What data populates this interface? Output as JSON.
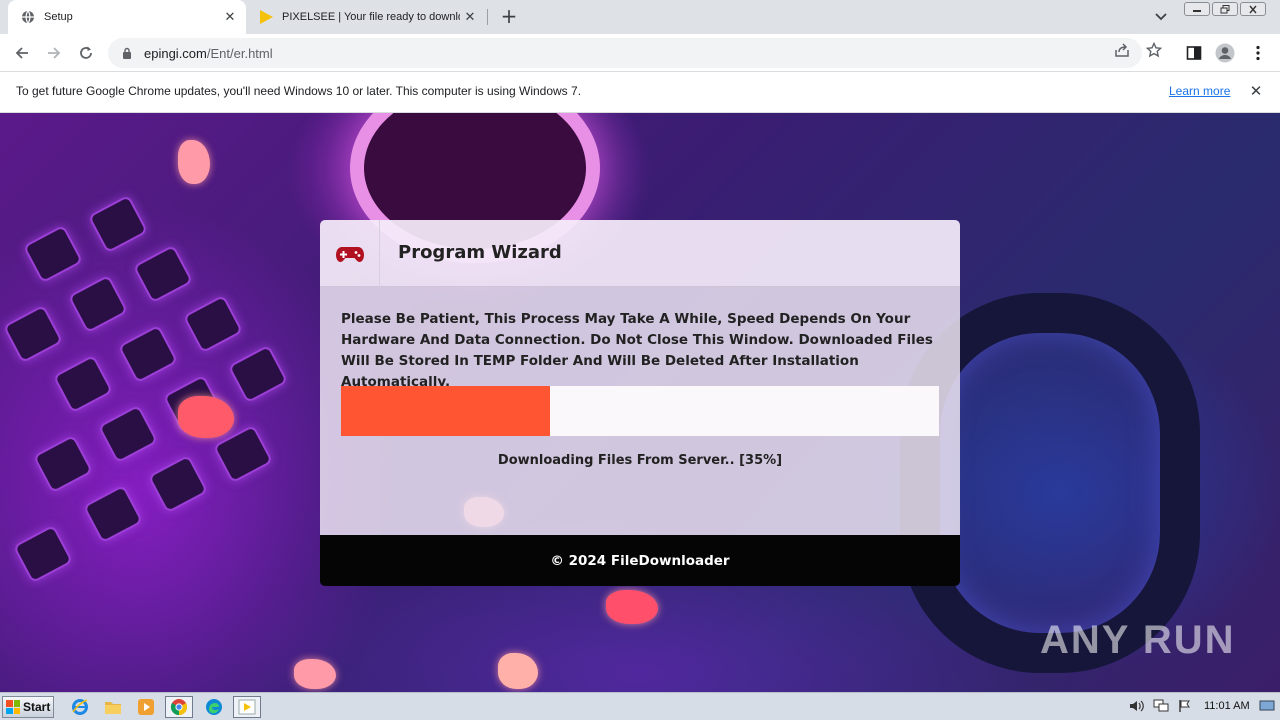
{
  "browser": {
    "tabs": [
      {
        "title": "Setup",
        "active": true,
        "icon": "globe-icon"
      },
      {
        "title": "PIXELSEE | Your file ready to downlo",
        "active": false,
        "icon": "play-icon"
      }
    ],
    "close_symbol": "✕",
    "newtab_symbol": "+",
    "address": {
      "host": "epingi.com",
      "path": "/Ent/er.html"
    }
  },
  "infobar": {
    "message": "To get future Google Chrome updates, you'll need Windows 10 or later. This computer is using Windows 7.",
    "link": "Learn more",
    "close_symbol": "✕"
  },
  "wizard": {
    "title": "Program Wizard",
    "description": "Please Be Patient, This Process May Take A While, Speed Depends On Your Hardware And Data Connection. Do Not Close This Window. Downloaded Files Will Be Stored In TEMP Folder And Will Be Deleted After Installation Automatically.",
    "progress_percent": 35,
    "status": "Downloading Files From Server.. [35%]",
    "footer": "© 2024 FileDownloader",
    "colors": {
      "progress": "#ff5533",
      "icon": "#b01020"
    }
  },
  "watermark": "ANY RUN",
  "taskbar": {
    "start_label": "Start",
    "clock": "11:01 AM"
  }
}
